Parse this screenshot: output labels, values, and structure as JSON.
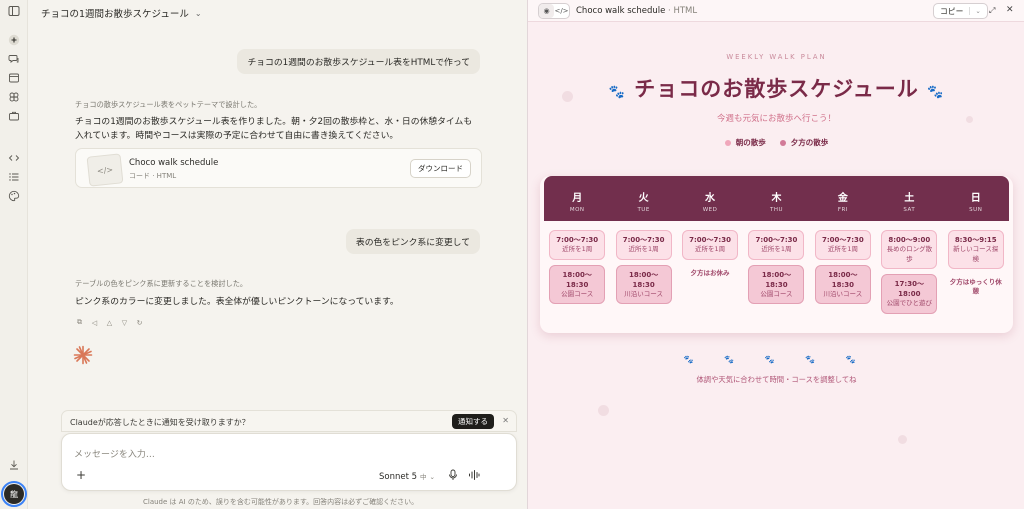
{
  "rail": {
    "avatar_label": "龍"
  },
  "chat": {
    "title": "チョコの1週間お散歩スケジュール",
    "user_msg_1": "チョコの1週間のお散歩スケジュール表をHTMLで作って",
    "thinking_1": "チョコの散歩スケジュール表をペットテーマで設計した。",
    "response_1": "チョコの1週間のお散歩スケジュール表を作りました。朝・夕2回の散歩枠と、水・日の休憩タイムも入れています。時間やコースは実際の予定に合わせて自由に書き換えてください。",
    "artifact": {
      "title": "Choco walk schedule",
      "subtitle": "コード · HTML",
      "download_label": "ダウンロード"
    },
    "user_msg_2": "表の色をピンク系に変更して",
    "thinking_2": "テーブルの色をピンク系に更新することを検討した。",
    "response_2": "ピンク系のカラーに変更しました。表全体が優しいピンクトーンになっています。",
    "notice": {
      "text": "Claudeが応答したときに通知を受け取りますか？",
      "button": "通知する"
    },
    "composer": {
      "placeholder": "メッセージを入力…",
      "model": "Sonnet 5",
      "model_sub": "中"
    },
    "disclaimer": "Claude は AI のため、誤りを含む可能性があります。回答内容は必ずご確認ください。"
  },
  "artifact_pane": {
    "title": "Choco walk schedule",
    "lang": "· HTML",
    "copy_label": "コピー",
    "eyebrow": "WEEKLY WALK PLAN",
    "heading": "チョコのお散歩スケジュール",
    "subheading": "今週も元気にお散歩へ行こう！",
    "legend": [
      {
        "label": "朝の散歩",
        "color": "#f0a7bb"
      },
      {
        "label": "夕方の散歩",
        "color": "#d27a98"
      }
    ],
    "days": [
      {
        "jp": "月",
        "en": "MON",
        "am": {
          "time": "7:00〜7:30",
          "place": "近所を1周"
        },
        "pm": {
          "time": "18:00〜18:30",
          "place": "公園コース"
        }
      },
      {
        "jp": "火",
        "en": "TUE",
        "am": {
          "time": "7:00〜7:30",
          "place": "近所を1周"
        },
        "pm": {
          "time": "18:00〜18:30",
          "place": "川沿いコース"
        }
      },
      {
        "jp": "水",
        "en": "WED",
        "am": {
          "time": "7:00〜7:30",
          "place": "近所を1周"
        },
        "rest": "夕方はお休み"
      },
      {
        "jp": "木",
        "en": "THU",
        "am": {
          "time": "7:00〜7:30",
          "place": "近所を1周"
        },
        "pm": {
          "time": "18:00〜18:30",
          "place": "公園コース"
        }
      },
      {
        "jp": "金",
        "en": "FRI",
        "am": {
          "time": "7:00〜7:30",
          "place": "近所を1周"
        },
        "pm": {
          "time": "18:00〜18:30",
          "place": "川沿いコース"
        }
      },
      {
        "jp": "土",
        "en": "SAT",
        "am": {
          "time": "8:00〜9:00",
          "place": "長めのロング散歩"
        },
        "pm": {
          "time": "17:30〜18:00",
          "place": "公園でひと遊び"
        }
      },
      {
        "jp": "日",
        "en": "SUN",
        "am": {
          "time": "8:30〜9:15",
          "place": "新しいコース探検"
        },
        "rest": "夕方はゆっくり休憩"
      }
    ],
    "paws": "🐾 🐾 🐾 🐾 🐾",
    "footnote": "体調や天気に合わせて時間・コースを調整してね"
  }
}
